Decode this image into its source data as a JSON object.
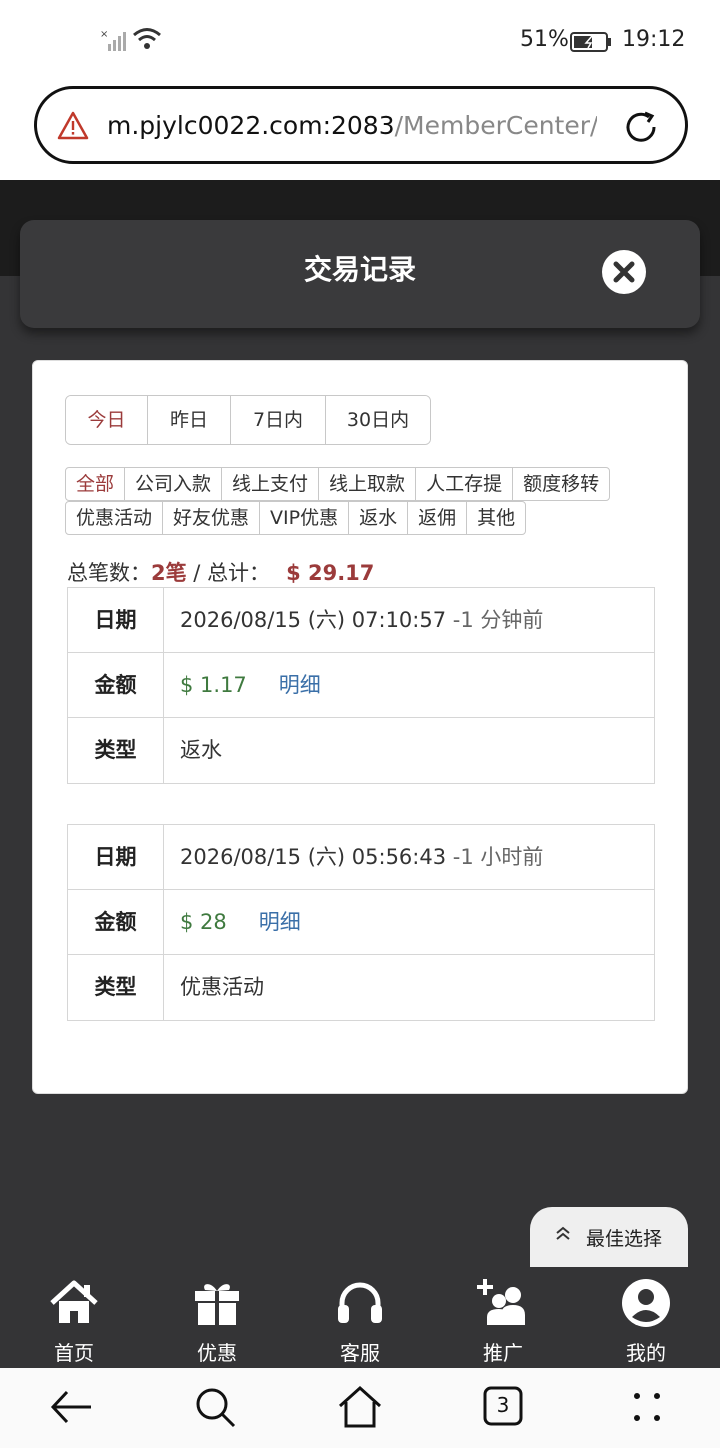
{
  "status_bar": {
    "battery_percent": "51%",
    "time": "19:12"
  },
  "url_bar": {
    "host": "m.pjylc0022.com:2083",
    "path": "/MemberCenter/T"
  },
  "header": {
    "title": "交易记录"
  },
  "date_filters": [
    {
      "label": "今日",
      "active": true
    },
    {
      "label": "昨日",
      "active": false
    },
    {
      "label": "7日内",
      "active": false
    },
    {
      "label": "30日内",
      "active": false
    }
  ],
  "type_filters_row1": [
    {
      "label": "全部",
      "active": true
    },
    {
      "label": "公司入款",
      "active": false
    },
    {
      "label": "线上支付",
      "active": false
    },
    {
      "label": "线上取款",
      "active": false
    },
    {
      "label": "人工存提",
      "active": false
    },
    {
      "label": "额度移转",
      "active": false
    }
  ],
  "type_filters_row2": [
    {
      "label": "优惠活动",
      "active": false
    },
    {
      "label": "好友优惠",
      "active": false
    },
    {
      "label": "VIP优惠",
      "active": false
    },
    {
      "label": "返水",
      "active": false
    },
    {
      "label": "返佣",
      "active": false
    },
    {
      "label": "其他",
      "active": false
    }
  ],
  "summary": {
    "count_label": "总笔数：",
    "count_value": "2笔",
    "separator": " / ",
    "total_label": "总计：",
    "total_value": "$ 29.17"
  },
  "records": [
    {
      "date_label": "日期",
      "date_value": "2026/08/15 (六) 07:10:57",
      "ago": "-1 分钟前",
      "amount_label": "金额",
      "amount_value": "$ 1.17",
      "detail_label": "明细",
      "type_label": "类型",
      "type_value": "返水"
    },
    {
      "date_label": "日期",
      "date_value": "2026/08/15 (六) 05:56:43",
      "ago": "-1 小时前",
      "amount_label": "金额",
      "amount_value": "$ 28",
      "detail_label": "明细",
      "type_label": "类型",
      "type_value": "优惠活动"
    }
  ],
  "best_choice": {
    "label": "最佳选择"
  },
  "bottom_nav": [
    {
      "label": "首页",
      "icon": "home-icon"
    },
    {
      "label": "优惠",
      "icon": "gift-icon"
    },
    {
      "label": "客服",
      "icon": "headset-icon"
    },
    {
      "label": "推广",
      "icon": "add-friends-icon"
    },
    {
      "label": "我的",
      "icon": "user-icon"
    }
  ],
  "system_nav": {
    "tab_count": "3"
  },
  "colors": {
    "accent_red": "#9b3b3b",
    "money_green": "#3f7a3f",
    "link_blue": "#3a6fa8",
    "page_dark": "#343436"
  }
}
